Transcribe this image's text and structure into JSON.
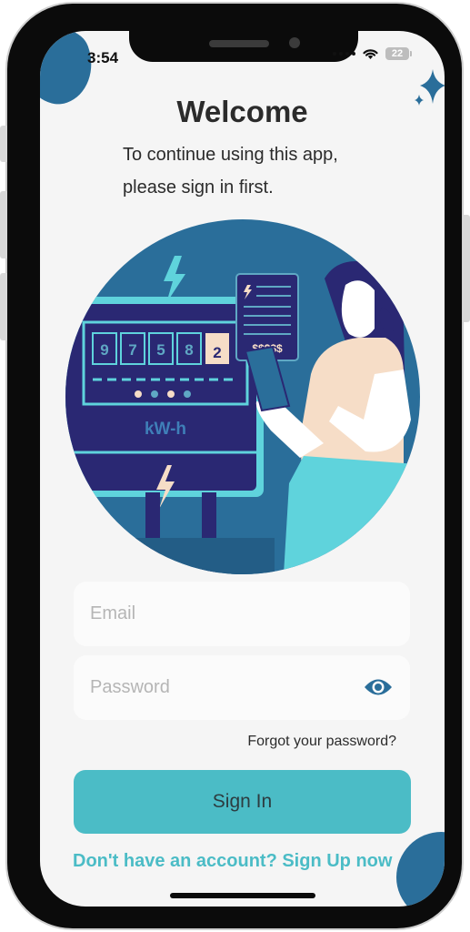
{
  "status_bar": {
    "time": "3:54",
    "battery": "22"
  },
  "header": {
    "title": "Welcome",
    "subtitle_line1": "To continue using this app,",
    "subtitle_line2": "please sign in first."
  },
  "illustration": {
    "meter_digits": [
      "9",
      "7",
      "5",
      "8",
      "2"
    ],
    "meter_unit": "kW-h",
    "bill_amount": "$$$$$"
  },
  "form": {
    "email": {
      "value": "",
      "placeholder": "Email"
    },
    "password": {
      "value": "",
      "placeholder": "Password"
    },
    "forgot_label": "Forgot your password?",
    "signin_label": "Sign In",
    "signup_label": "Don't have an account? Sign Up now"
  },
  "icons": {
    "password_toggle": "eye-icon"
  },
  "colors": {
    "accent": "#4bbcc6",
    "navy": "#2a6e9a",
    "text": "#2b2b2b",
    "background": "#f5f5f5"
  }
}
